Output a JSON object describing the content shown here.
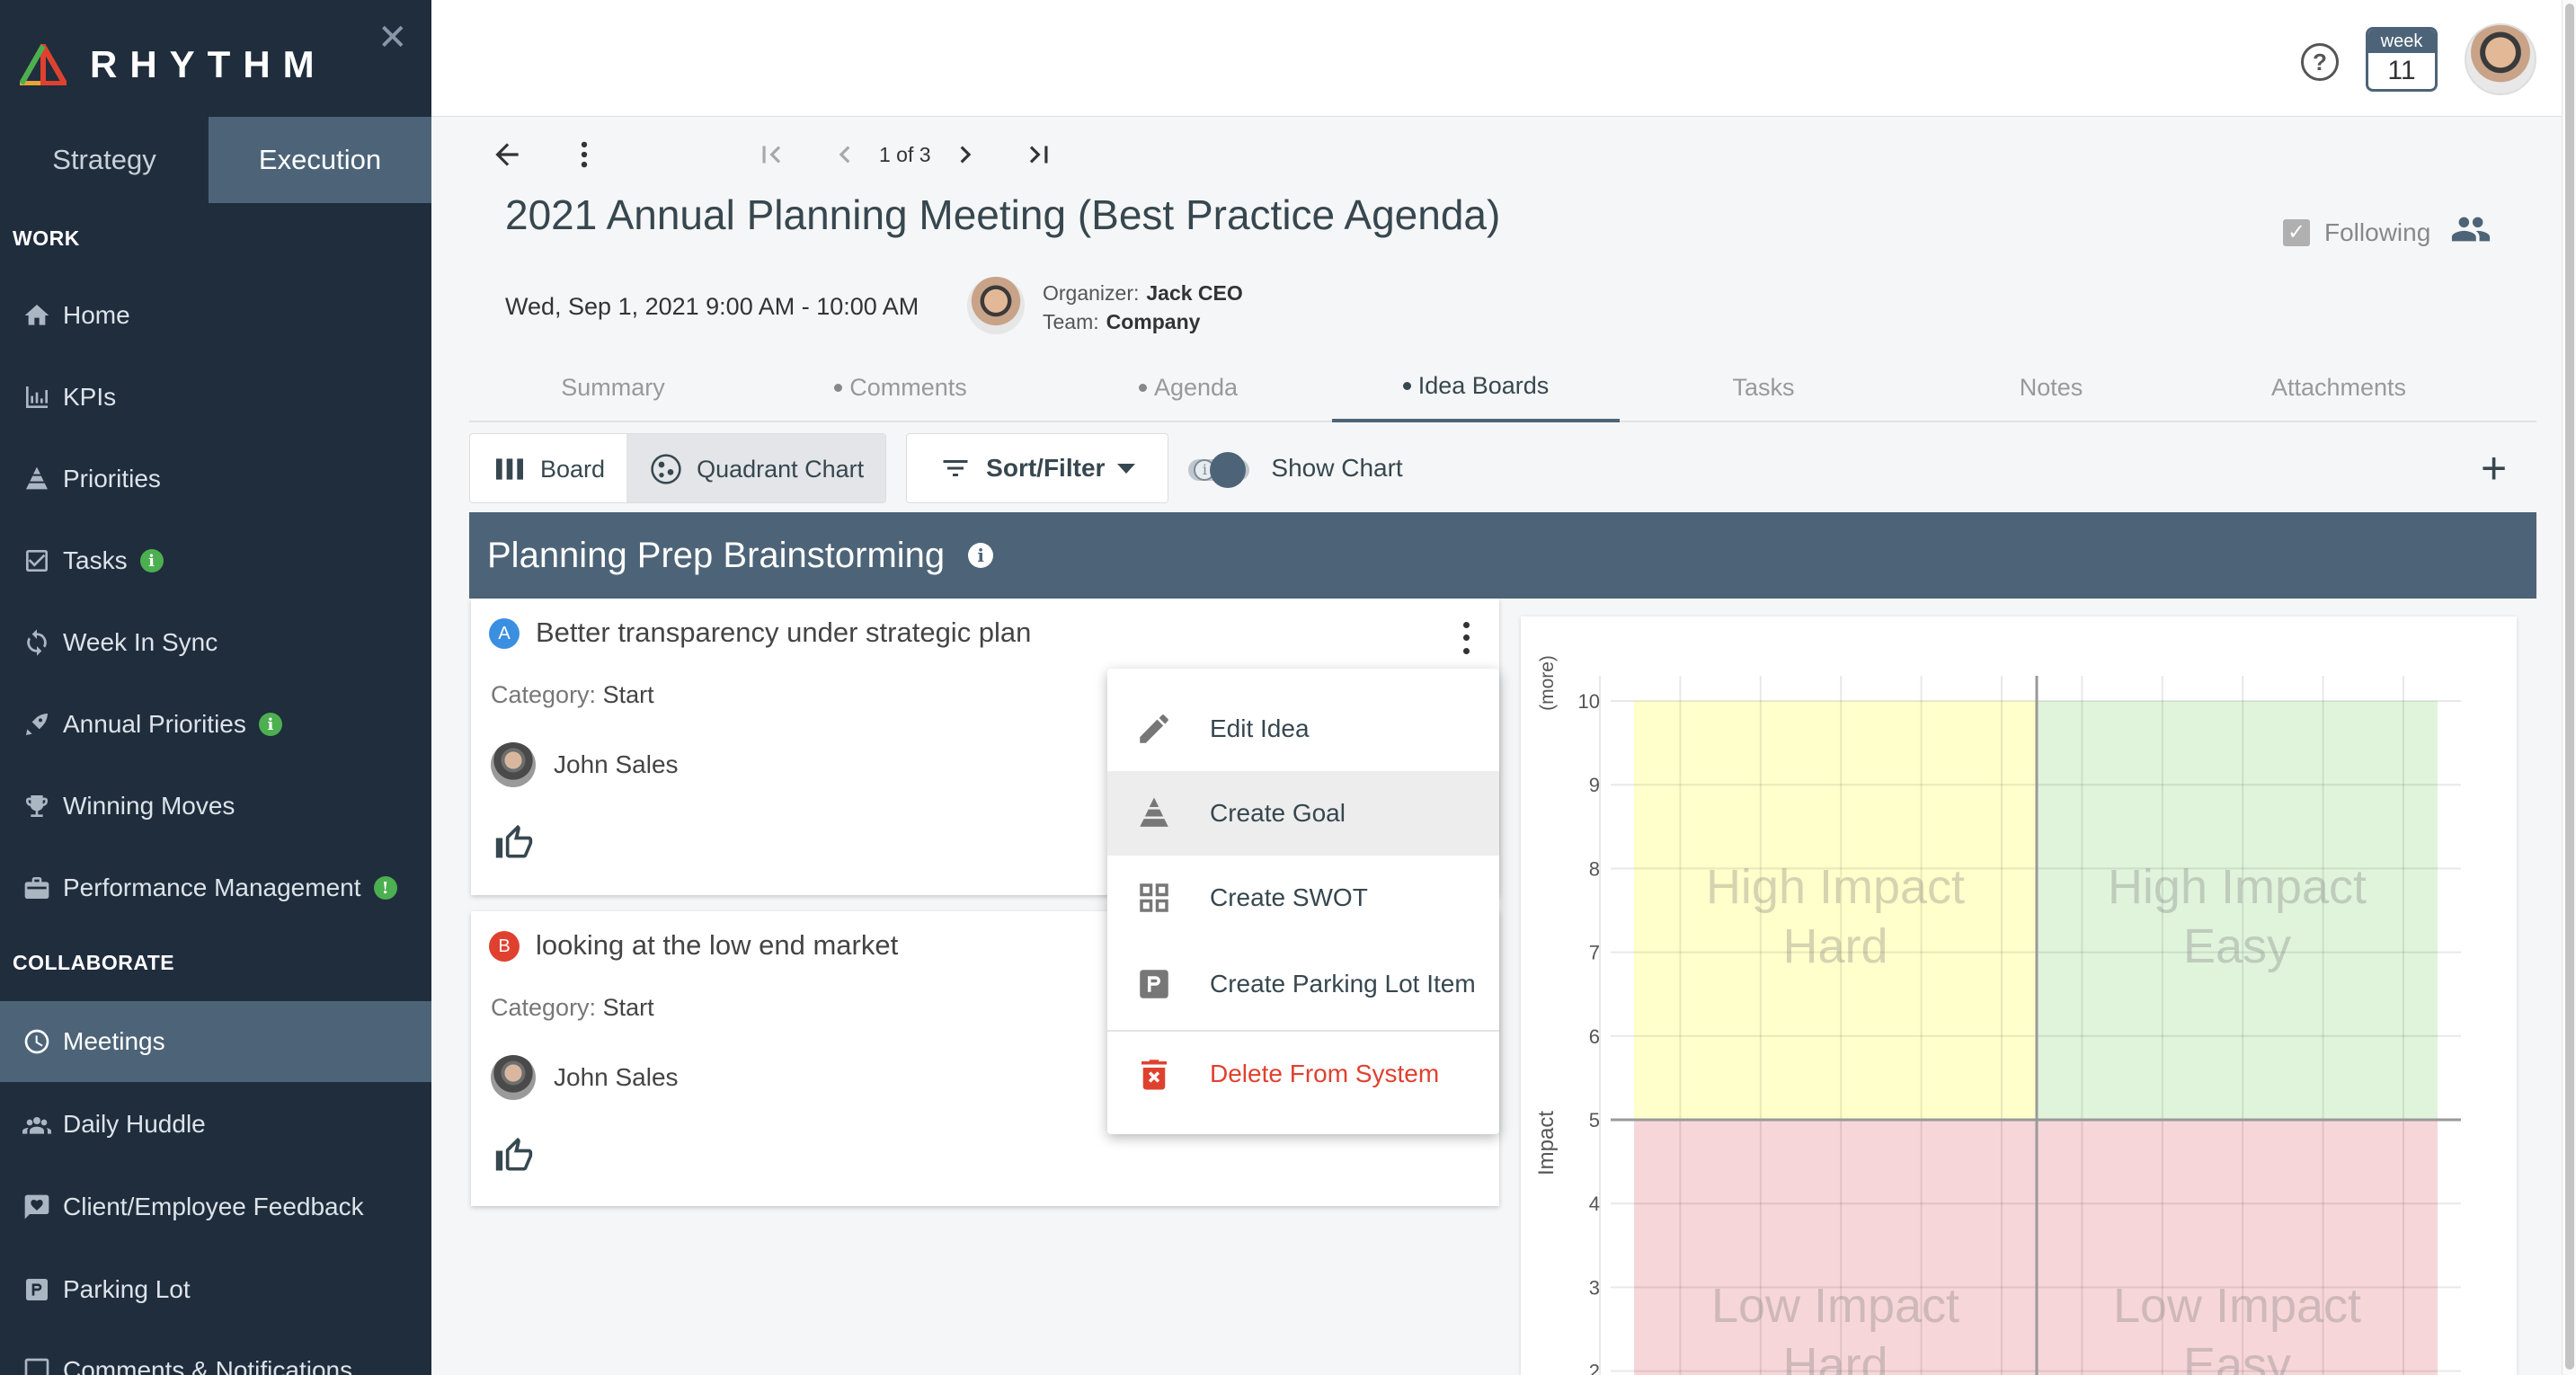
{
  "app": {
    "logo_text": "RHYTHM"
  },
  "sidebar": {
    "modes": [
      "Strategy",
      "Execution"
    ],
    "sections": {
      "work": "WORK",
      "collaborate": "COLLABORATE"
    },
    "work_items": [
      {
        "label": "Home",
        "icon": "home-icon"
      },
      {
        "label": "KPIs",
        "icon": "kpi-icon"
      },
      {
        "label": "Priorities",
        "icon": "pyramid-icon"
      },
      {
        "label": "Tasks",
        "icon": "task-check-icon",
        "badge": "i"
      },
      {
        "label": "Week In Sync",
        "icon": "sync-icon"
      },
      {
        "label": "Annual Priorities",
        "icon": "rocket-icon",
        "badge": "i"
      },
      {
        "label": "Winning Moves",
        "icon": "trophy-icon"
      },
      {
        "label": "Performance Management",
        "icon": "briefcase-icon",
        "badge": "!"
      }
    ],
    "collaborate_items": [
      {
        "label": "Meetings",
        "icon": "clock-icon"
      },
      {
        "label": "Daily Huddle",
        "icon": "group-icon"
      },
      {
        "label": "Client/Employee Feedback",
        "icon": "heart-chat-icon"
      },
      {
        "label": "Parking Lot",
        "icon": "parking-icon"
      },
      {
        "label": "Comments & Notifications",
        "icon": "comment-icon"
      }
    ]
  },
  "topbar": {
    "week_label": "week",
    "week_number": "11",
    "help_symbol": "?"
  },
  "meeting": {
    "pager": "1 of 3",
    "title": "2021 Annual Planning Meeting (Best Practice Agenda)",
    "following_label": "Following",
    "datetime": "Wed, Sep 1, 2021 9:00 AM - 10:00 AM",
    "organizer_label": "Organizer:",
    "organizer": "Jack CEO",
    "team_label": "Team:",
    "team": "Company"
  },
  "tabs": [
    {
      "label": "Summary",
      "dot": false
    },
    {
      "label": "Comments",
      "dot": true
    },
    {
      "label": "Agenda",
      "dot": true
    },
    {
      "label": "Idea Boards",
      "dot": true
    },
    {
      "label": "Tasks",
      "dot": false
    },
    {
      "label": "Notes",
      "dot": false
    },
    {
      "label": "Attachments",
      "dot": false
    }
  ],
  "toolbar": {
    "board_label": "Board",
    "quadrant_label": "Quadrant Chart",
    "sort_label": "Sort/Filter",
    "show_chart_label": "Show Chart",
    "add_symbol": "+"
  },
  "board": {
    "title": "Planning Prep Brainstorming",
    "ideas": [
      {
        "letter": "A",
        "title": "Better transparency under strategic plan",
        "category_label": "Category:",
        "category": "Start",
        "owner": "John Sales"
      },
      {
        "letter": "B",
        "title": "looking at the low end market",
        "category_label": "Category:",
        "category": "Start",
        "owner": "John Sales"
      }
    ]
  },
  "context_menu": {
    "items": [
      {
        "label": "Edit Idea",
        "icon": "pencil-icon"
      },
      {
        "label": "Create Goal",
        "icon": "pyramid-icon"
      },
      {
        "label": "Create SWOT",
        "icon": "grid-icon"
      },
      {
        "label": "Create Parking Lot Item",
        "icon": "parking-icon"
      },
      {
        "label": "Delete From System",
        "icon": "trash-icon"
      }
    ]
  },
  "colors": {
    "sidebar_bg": "#1f2d3d",
    "accent": "#4d6478",
    "danger": "#e0412f",
    "quadrant_high_hard": "#ffffcc",
    "quadrant_high_easy": "#e0f4dc",
    "quadrant_low": "#f7d6d9"
  },
  "chart_data": {
    "type": "scatter",
    "ylabel": "Impact",
    "ylabel_top": "(more)",
    "ylim": [
      0,
      10
    ],
    "visible_y_ticks": [
      10,
      9,
      8,
      7,
      6,
      5,
      4,
      3,
      2
    ],
    "quadrants": [
      {
        "line1": "High Impact",
        "line2": "Hard"
      },
      {
        "line1": "High Impact",
        "line2": "Easy"
      },
      {
        "line1": "Low Impact",
        "line2": "Hard"
      },
      {
        "line1": "Low Impact",
        "line2": "Easy"
      }
    ],
    "grid": true
  }
}
